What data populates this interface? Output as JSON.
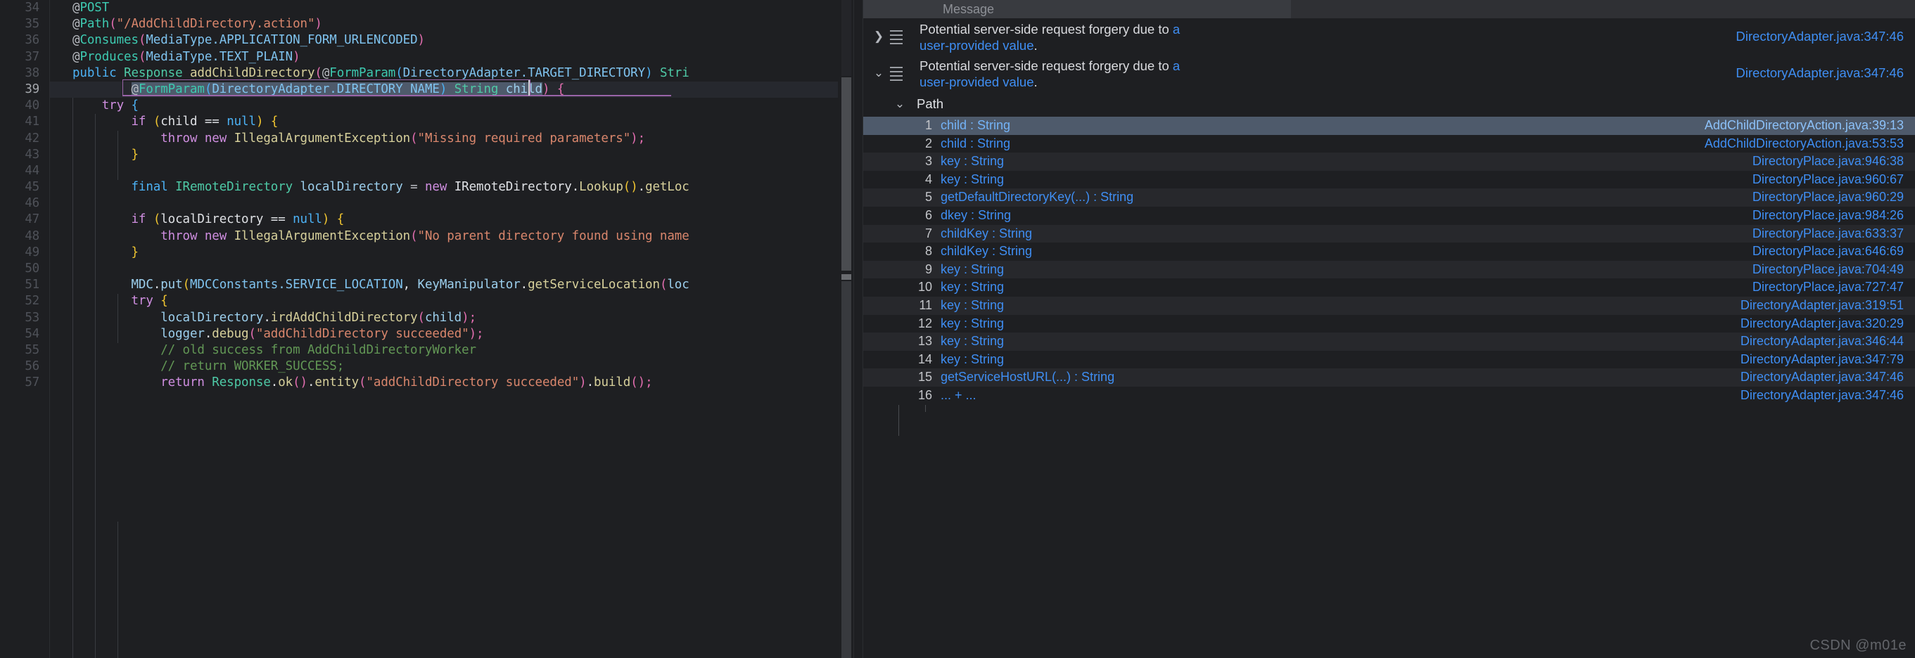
{
  "editor": {
    "first_line_number": 34,
    "current_line_number": 39,
    "lines": [
      {
        "n": "34",
        "indent": 1
      },
      {
        "n": "35",
        "indent": 1
      },
      {
        "n": "36",
        "indent": 1
      },
      {
        "n": "37",
        "indent": 1
      },
      {
        "n": "38",
        "indent": 1
      },
      {
        "n": "39",
        "indent": 1
      },
      {
        "n": "40",
        "indent": 1
      },
      {
        "n": "41",
        "indent": 2
      },
      {
        "n": "42",
        "indent": 3
      },
      {
        "n": "43",
        "indent": 2
      },
      {
        "n": "44",
        "indent": 2
      },
      {
        "n": "45",
        "indent": 2
      },
      {
        "n": "46",
        "indent": 2
      },
      {
        "n": "47",
        "indent": 2
      },
      {
        "n": "48",
        "indent": 3
      },
      {
        "n": "49",
        "indent": 2
      },
      {
        "n": "50",
        "indent": 2
      },
      {
        "n": "51",
        "indent": 2
      },
      {
        "n": "52",
        "indent": 2
      },
      {
        "n": "53",
        "indent": 3
      },
      {
        "n": "54",
        "indent": 3
      },
      {
        "n": "55",
        "indent": 3
      },
      {
        "n": "56",
        "indent": 3
      },
      {
        "n": "57",
        "indent": 3
      }
    ],
    "code_text": [
      "@POST",
      "@Path(\"/AddChildDirectory.action\")",
      "@Consumes(MediaType.APPLICATION_FORM_URLENCODED)",
      "@Produces(MediaType.TEXT_PLAIN)",
      "public Response addChildDirectory(@FormParam(DirectoryAdapter.TARGET_DIRECTORY) Stri",
      "        @FormParam(DirectoryAdapter.DIRECTORY_NAME) String child) {",
      "    try {",
      "        if (child == null) {",
      "            throw new IllegalArgumentException(\"Missing required parameters\");",
      "        }",
      "",
      "        final IRemoteDirectory localDirectory = new IRemoteDirectory.Lookup().getLoc",
      "",
      "        if (localDirectory == null) {",
      "            throw new IllegalArgumentException(\"No parent directory found using name",
      "        }",
      "",
      "        MDC.put(MDCConstants.SERVICE_LOCATION, KeyManipulator.getServiceLocation(loc",
      "        try {",
      "            localDirectory.irdAddChildDirectory(child);",
      "            logger.debug(\"addChildDirectory succeeded\");",
      "            // old success from AddChildDirectoryWorker",
      "            // return WORKER_SUCCESS;",
      "            return Response.ok().entity(\"addChildDirectory succeeded\").build();"
    ]
  },
  "panel": {
    "column_header": "Message",
    "findings": [
      {
        "chevron": "collapsed",
        "text_plain": "Potential server-side request forgery due to ",
        "text_link_1": "a",
        "text_line2_link": "user-provided value",
        "text_line2_end": ".",
        "location": "DirectoryAdapter.java:347:46"
      },
      {
        "chevron": "expanded",
        "text_plain": "Potential server-side request forgery due to ",
        "text_link_1": "a",
        "text_line2_link": "user-provided value",
        "text_line2_end": ".",
        "location": "DirectoryAdapter.java:347:46"
      }
    ],
    "path_group_label": "Path",
    "path_items": [
      {
        "index": "1",
        "label": "child : String",
        "location": "AddChildDirectoryAction.java:39:13",
        "selected": true
      },
      {
        "index": "2",
        "label": "child : String",
        "location": "AddChildDirectoryAction.java:53:53",
        "selected": false
      },
      {
        "index": "3",
        "label": "key : String",
        "location": "DirectoryPlace.java:946:38",
        "selected": false
      },
      {
        "index": "4",
        "label": "key : String",
        "location": "DirectoryPlace.java:960:67",
        "selected": false
      },
      {
        "index": "5",
        "label": "getDefaultDirectoryKey(...) : String",
        "location": "DirectoryPlace.java:960:29",
        "selected": false
      },
      {
        "index": "6",
        "label": "dkey : String",
        "location": "DirectoryPlace.java:984:26",
        "selected": false
      },
      {
        "index": "7",
        "label": "childKey : String",
        "location": "DirectoryPlace.java:633:37",
        "selected": false
      },
      {
        "index": "8",
        "label": "childKey : String",
        "location": "DirectoryPlace.java:646:69",
        "selected": false
      },
      {
        "index": "9",
        "label": "key : String",
        "location": "DirectoryPlace.java:704:49",
        "selected": false
      },
      {
        "index": "10",
        "label": "key : String",
        "location": "DirectoryPlace.java:727:47",
        "selected": false
      },
      {
        "index": "11",
        "label": "key : String",
        "location": "DirectoryAdapter.java:319:51",
        "selected": false
      },
      {
        "index": "12",
        "label": "key : String",
        "location": "DirectoryAdapter.java:320:29",
        "selected": false
      },
      {
        "index": "13",
        "label": "key : String",
        "location": "DirectoryAdapter.java:346:44",
        "selected": false
      },
      {
        "index": "14",
        "label": "key : String",
        "location": "DirectoryAdapter.java:347:79",
        "selected": false
      },
      {
        "index": "15",
        "label": "getServiceHostURL(...) : String",
        "location": "DirectoryAdapter.java:347:46",
        "selected": false
      },
      {
        "index": "16",
        "label": "... + ...",
        "location": "DirectoryAdapter.java:347:46",
        "selected": false
      }
    ]
  },
  "watermark": "CSDN @m01e",
  "colors": {
    "editor_bg": "#1e1f22",
    "panel_bg": "#1e1f22",
    "link_blue": "#3f8ef3",
    "selection_blue": "#4e5a6b",
    "header_gray": "#393b40"
  }
}
